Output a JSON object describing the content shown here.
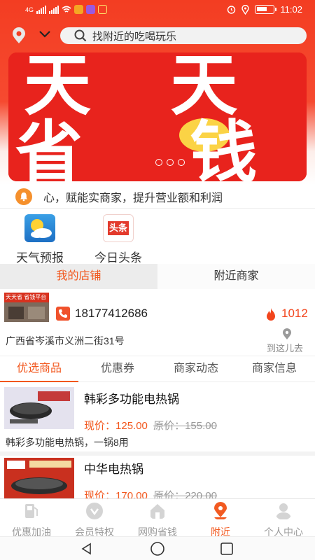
{
  "status_bar": {
    "network": "4G",
    "time": "11:02",
    "battery": ""
  },
  "header": {
    "search_placeholder": "找附近的吃喝玩乐"
  },
  "banner": {
    "line1": "天 天",
    "line2": "省 钱",
    "page_count": 4,
    "active_page": 0
  },
  "notice": {
    "text": "心，赋能实商家，提升营业额和利润"
  },
  "quick_links": [
    {
      "label": "天气预报",
      "icon": "weather-icon"
    },
    {
      "label": "今日头条",
      "icon": "toutiao-icon",
      "icon_text": "头条"
    }
  ],
  "store_tabs": [
    {
      "label": "我的店铺",
      "active": true
    },
    {
      "label": "附近商家",
      "active": false
    }
  ],
  "store": {
    "phone": "18177412686",
    "hot_count": "1012",
    "address": "广西省岑溪市义洲二街31号",
    "navigate_label": "到这儿去",
    "thumb_text": "天天省 省钱平台"
  },
  "section_tabs": [
    {
      "label": "优选商品",
      "active": true
    },
    {
      "label": "优惠券",
      "active": false
    },
    {
      "label": "商家动态",
      "active": false
    },
    {
      "label": "商家信息",
      "active": false
    }
  ],
  "products": [
    {
      "name": "韩彩多功能电热锅",
      "price_label": "现价：",
      "price": "125.00",
      "orig_label": "原价：",
      "orig_price": "155.00",
      "desc": "韩彩多功能电热锅，一锅8用"
    },
    {
      "name": "中华电热锅",
      "price_label": "现价：",
      "price": "170.00",
      "orig_label": "原价：",
      "orig_price": "220.00",
      "desc": ""
    }
  ],
  "bottom_nav": [
    {
      "label": "优惠加油",
      "icon": "fuel-icon",
      "active": false
    },
    {
      "label": "会员特权",
      "icon": "vip-icon",
      "active": false
    },
    {
      "label": "网购省钱",
      "icon": "shop-icon",
      "active": false
    },
    {
      "label": "附近",
      "icon": "nearby-icon",
      "active": true
    },
    {
      "label": "个人中心",
      "icon": "user-icon",
      "active": false
    }
  ],
  "colors": {
    "brand": "#f33d22",
    "accent": "#f2561c",
    "price": "#f2561c"
  }
}
